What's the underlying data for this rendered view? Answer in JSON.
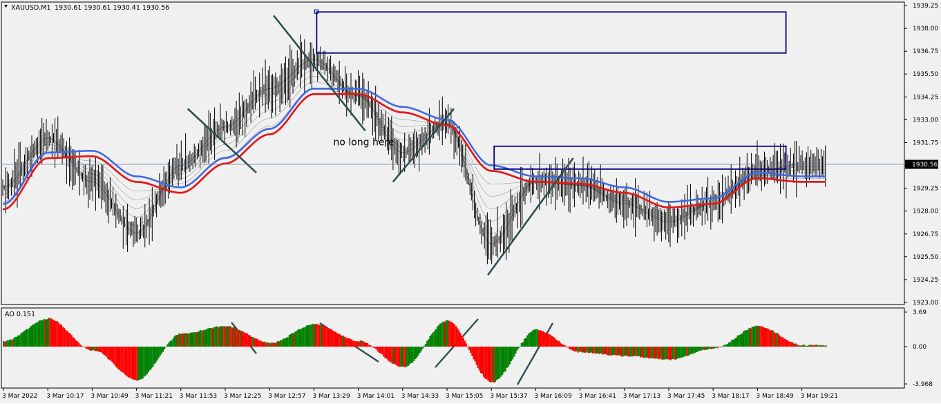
{
  "header": {
    "symbol_label": "XAUUSD,M1",
    "ohlc_label": "1930.61 1930.61 1930.41 1930.56"
  },
  "price_panel": {
    "y_ticks": [
      "1939.25",
      "1938.00",
      "1936.75",
      "1935.50",
      "1934.25",
      "1933.00",
      "1931.75",
      "1930.50",
      "1929.25",
      "1928.00",
      "1926.75",
      "1925.50",
      "1924.25",
      "1923.00"
    ],
    "current_price": "1930.56",
    "annotation": "no long here"
  },
  "ao_panel": {
    "label": "AO 0.151",
    "y_ticks": [
      "3.69",
      "0.00",
      "-3.968"
    ]
  },
  "x_ticks": [
    "3 Mar 2022",
    "3 Mar 10:17",
    "3 Mar 10:49",
    "3 Mar 11:21",
    "3 Mar 11:53",
    "3 Mar 12:25",
    "3 Mar 12:57",
    "3 Mar 13:29",
    "3 Mar 14:01",
    "3 Mar 14:33",
    "3 Mar 15:05",
    "3 Mar 15:37",
    "3 Mar 16:09",
    "3 Mar 16:41",
    "3 Mar 17:13",
    "3 Mar 17:45",
    "3 Mar 18:17",
    "3 Mar 18:49",
    "3 Mar 19:21"
  ],
  "colors": {
    "background": "#f0f0f0",
    "candle": "#000000",
    "ema_red": "#e11b1b",
    "ema_blue": "#4169e1",
    "ribbon": "#8a8a8a",
    "ao_up": "#008000",
    "ao_down": "#ff0000",
    "box": "#000080",
    "trendline": "#2f4f4f",
    "current_price_bg": "#000000"
  },
  "chart_data": {
    "type": "candlestick",
    "symbol": "XAUUSD",
    "timeframe": "M1",
    "ylim": [
      1923.0,
      1939.25
    ],
    "close_path": [
      {
        "t": "3 Mar 2022",
        "price": 1929.3
      },
      {
        "t": "3 Mar 10:17",
        "price": 1932.0
      },
      {
        "t": "3 Mar 10:49",
        "price": 1929.6
      },
      {
        "t": "3 Mar 11:21",
        "price": 1926.8
      },
      {
        "t": "3 Mar 11:53",
        "price": 1930.5
      },
      {
        "t": "3 Mar 12:25",
        "price": 1932.6
      },
      {
        "t": "3 Mar 12:57",
        "price": 1934.7
      },
      {
        "t": "3 Mar 13:29",
        "price": 1936.3
      },
      {
        "t": "3 Mar 14:01",
        "price": 1934.3
      },
      {
        "t": "3 Mar 14:33",
        "price": 1931.2
      },
      {
        "t": "3 Mar 15:05",
        "price": 1932.8
      },
      {
        "t": "3 Mar 15:37",
        "price": 1926.2
      },
      {
        "t": "3 Mar 16:09",
        "price": 1929.6
      },
      {
        "t": "3 Mar 16:41",
        "price": 1929.4
      },
      {
        "t": "3 Mar 17:13",
        "price": 1928.4
      },
      {
        "t": "3 Mar 17:45",
        "price": 1927.4
      },
      {
        "t": "3 Mar 18:17",
        "price": 1928.4
      },
      {
        "t": "3 Mar 18:49",
        "price": 1930.2
      },
      {
        "t": "3 Mar 19:21",
        "price": 1930.56
      }
    ],
    "ema_path": [
      {
        "t": "3 Mar 2022",
        "price": 1928.1
      },
      {
        "t": "3 Mar 10:17",
        "price": 1930.9
      },
      {
        "t": "3 Mar 10:49",
        "price": 1931.0
      },
      {
        "t": "3 Mar 11:21",
        "price": 1929.6
      },
      {
        "t": "3 Mar 11:53",
        "price": 1929.0
      },
      {
        "t": "3 Mar 12:25",
        "price": 1930.6
      },
      {
        "t": "3 Mar 12:57",
        "price": 1932.2
      },
      {
        "t": "3 Mar 13:29",
        "price": 1934.4
      },
      {
        "t": "3 Mar 14:01",
        "price": 1934.4
      },
      {
        "t": "3 Mar 14:33",
        "price": 1933.4
      },
      {
        "t": "3 Mar 15:05",
        "price": 1932.7
      },
      {
        "t": "3 Mar 15:37",
        "price": 1930.2
      },
      {
        "t": "3 Mar 16:09",
        "price": 1929.6
      },
      {
        "t": "3 Mar 16:41",
        "price": 1929.5
      },
      {
        "t": "3 Mar 17:13",
        "price": 1929.0
      },
      {
        "t": "3 Mar 17:45",
        "price": 1928.2
      },
      {
        "t": "3 Mar 18:17",
        "price": 1928.4
      },
      {
        "t": "3 Mar 18:49",
        "price": 1929.8
      },
      {
        "t": "3 Mar 19:21",
        "price": 1929.6
      }
    ],
    "ao_path": [
      {
        "t": "3 Mar 2022",
        "value": 0.6
      },
      {
        "t": "3 Mar 10:17",
        "value": 3.0
      },
      {
        "t": "3 Mar 10:49",
        "value": -0.4
      },
      {
        "t": "3 Mar 11:21",
        "value": -3.6
      },
      {
        "t": "3 Mar 11:53",
        "value": 1.4
      },
      {
        "t": "3 Mar 12:25",
        "value": 2.2
      },
      {
        "t": "3 Mar 12:57",
        "value": 0.4
      },
      {
        "t": "3 Mar 13:29",
        "value": 2.4
      },
      {
        "t": "3 Mar 14:01",
        "value": 0.6
      },
      {
        "t": "3 Mar 14:33",
        "value": -2.2
      },
      {
        "t": "3 Mar 15:05",
        "value": 2.8
      },
      {
        "t": "3 Mar 15:37",
        "value": -3.8
      },
      {
        "t": "3 Mar 16:09",
        "value": 1.8
      },
      {
        "t": "3 Mar 16:41",
        "value": -0.6
      },
      {
        "t": "3 Mar 17:13",
        "value": -1.0
      },
      {
        "t": "3 Mar 17:45",
        "value": -1.4
      },
      {
        "t": "3 Mar 18:17",
        "value": -0.2
      },
      {
        "t": "3 Mar 18:49",
        "value": 2.2
      },
      {
        "t": "3 Mar 19:21",
        "value": 0.151
      }
    ],
    "annotations": {
      "rectangles": [
        {
          "t_from": "3 Mar 13:29",
          "t_to": "3 Mar 19:21",
          "price_from": 1936.65,
          "price_to": 1938.9
        },
        {
          "t_from": "3 Mar 15:37",
          "t_to": "3 Mar 19:21",
          "price_from": 1930.3,
          "price_to": 1931.55
        }
      ],
      "trendlines": [
        {
          "from": {
            "t": "3 Mar 11:53",
            "price": 1933.6
          },
          "to": {
            "t": "3 Mar 12:25",
            "price": 1930.1
          }
        },
        {
          "from": {
            "t": "3 Mar 12:57",
            "price": 1938.7
          },
          "to": {
            "t": "3 Mar 14:01",
            "price": 1932.4
          }
        },
        {
          "from": {
            "t": "3 Mar 14:33",
            "price": 1929.6
          },
          "to": {
            "t": "3 Mar 15:05",
            "price": 1933.6
          }
        },
        {
          "from": {
            "t": "3 Mar 15:37",
            "price": 1924.5
          },
          "to": {
            "t": "3 Mar 16:41",
            "price": 1930.9
          }
        }
      ],
      "text": "no long here"
    }
  }
}
